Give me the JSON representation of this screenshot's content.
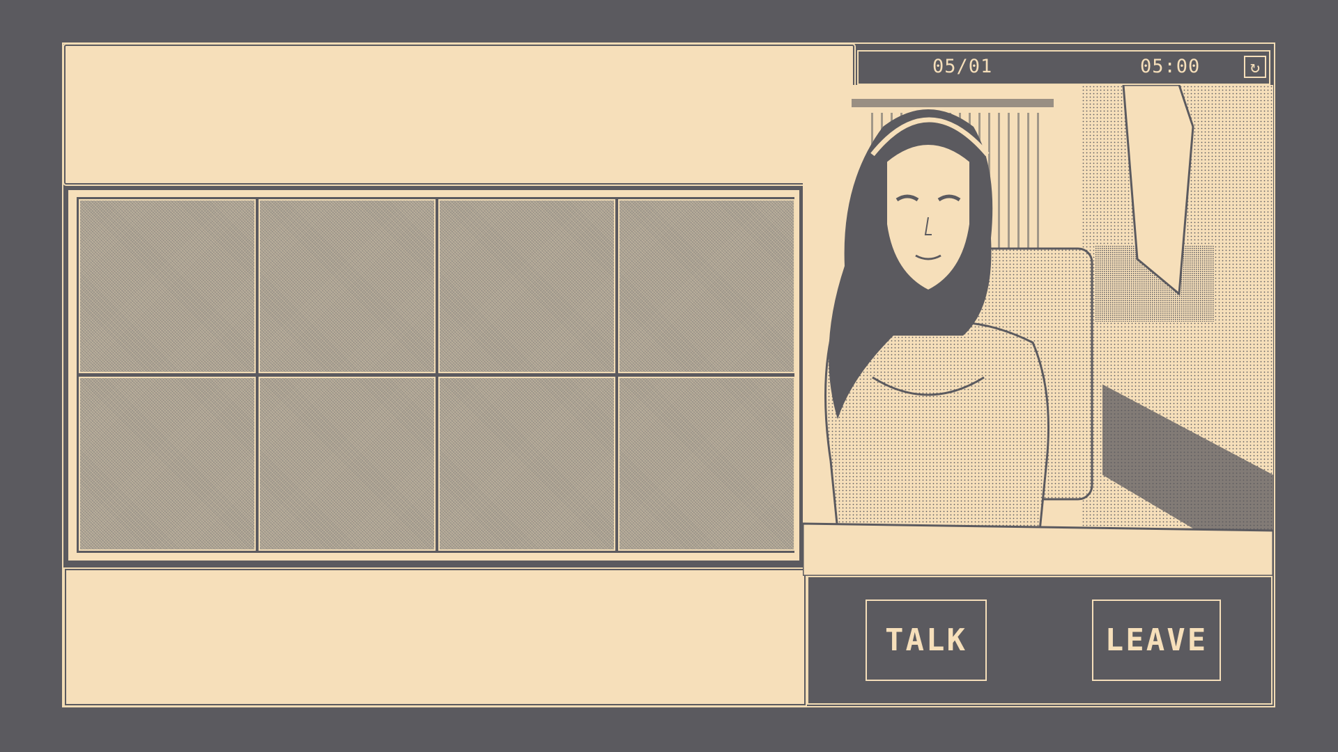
{
  "status": {
    "date": "05/01",
    "time": "05:00"
  },
  "icons": {
    "refresh": "refresh-icon"
  },
  "actions": {
    "talk_label": "TALK",
    "leave_label": "LEAVE"
  },
  "colors": {
    "background": "#5b5a5f",
    "panel": "#f6dfba",
    "accent": "#f2dcb5"
  },
  "inventory": {
    "slots": 8
  }
}
